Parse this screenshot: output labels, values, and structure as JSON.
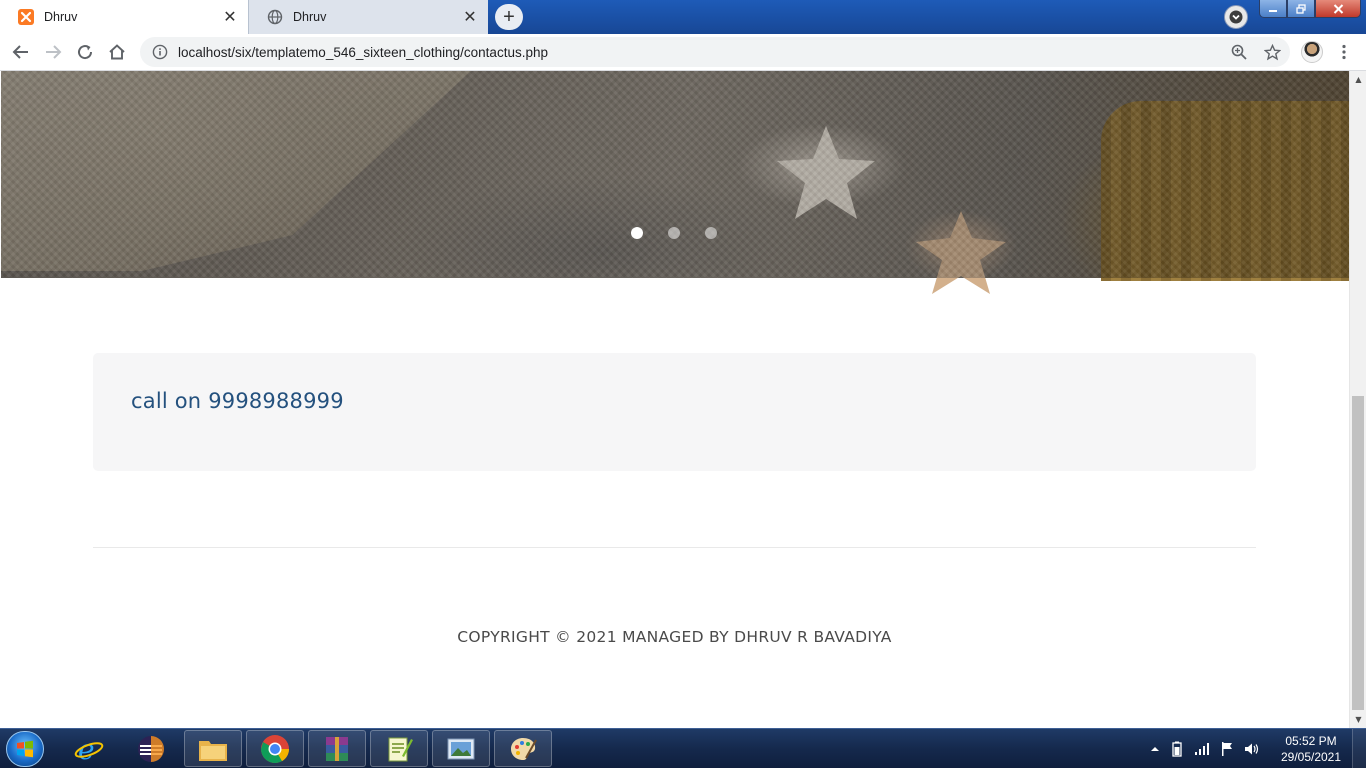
{
  "browser": {
    "tabs": [
      {
        "title": "Dhruv",
        "active": true,
        "favicon": "xampp-icon"
      },
      {
        "title": "Dhruv",
        "active": false,
        "favicon": "globe-icon"
      }
    ],
    "new_tab_label": "+",
    "url": "localhost/six/templatemo_546_sixteen_clothing/contactus.php"
  },
  "page": {
    "carousel": {
      "slide_count": 3,
      "active_slide": 1
    },
    "contact_text": "call on 9998988999",
    "copyright": "COPYRIGHT © 2021 MANAGED BY DHRUV R BAVADIYA"
  },
  "taskbar": {
    "apps": [
      "internet-explorer-icon",
      "eclipse-icon",
      "file-explorer-icon",
      "chrome-icon",
      "winrar-icon",
      "notepad-plus-icon",
      "photo-viewer-icon",
      "paint-icon"
    ],
    "clock_time": "05:52 PM",
    "clock_date": "29/05/2021"
  },
  "colors": {
    "accent_link": "#24517e",
    "footer_text": "#4a4a4a",
    "contact_bg": "#f6f6f7",
    "titlebar": "#1a4fa3"
  }
}
